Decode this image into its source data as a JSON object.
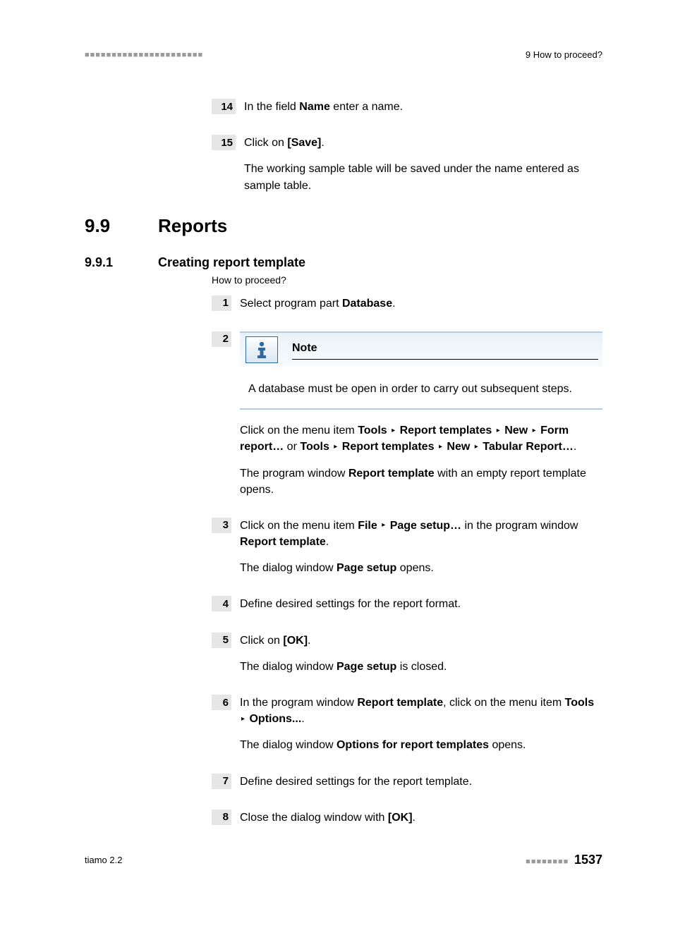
{
  "header": {
    "left_decoration": "■■■■■■■■■■■■■■■■■■■■■■",
    "right": "9 How to proceed?"
  },
  "top_steps": {
    "s14": {
      "num": "14",
      "pre": "In the field ",
      "bold": "Name",
      "post": " enter a name."
    },
    "s15": {
      "num": "15",
      "pre": "Click on ",
      "bold": "[Save]",
      "post": ".",
      "para2": "The working sample table will be saved under the name entered as sample table."
    }
  },
  "h1": {
    "num": "9.9",
    "title": "Reports"
  },
  "h2": {
    "num": "9.9.1",
    "title": "Creating report template"
  },
  "subcaption": "How to proceed?",
  "steps": {
    "s1": {
      "num": "1",
      "pre": "Select program part ",
      "bold": "Database",
      "post": "."
    },
    "s2": {
      "num": "2",
      "note_title": "Note",
      "note_body": "A database must be open in order to carry out subsequent steps.",
      "menu": {
        "pre": "Click on the menu item ",
        "t1": "Tools",
        "arrow": "▸",
        "t2": "Report templates",
        "t3": "New",
        "t4": "Form report…",
        "or": " or ",
        "u1": "Tools",
        "u2": "Report templates",
        "u3": "New",
        "u4": "Tabular Report…",
        "post": "."
      },
      "p2_pre": "The program window ",
      "p2_bold": "Report template",
      "p2_post": " with an empty report template opens."
    },
    "s3": {
      "num": "3",
      "p1_pre": "Click on the menu item ",
      "p1_b1": "File",
      "arrow": "▸",
      "p1_b2": "Page setup…",
      "p1_mid": " in the program window ",
      "p1_b3": "Report template",
      "p1_post": ".",
      "p2_pre": "The dialog window ",
      "p2_bold": "Page setup",
      "p2_post": " opens."
    },
    "s4": {
      "num": "4",
      "text": "Define desired settings for the report format."
    },
    "s5": {
      "num": "5",
      "p1_pre": "Click on ",
      "p1_bold": "[OK]",
      "p1_post": ".",
      "p2_pre": "The dialog window ",
      "p2_bold": "Page setup",
      "p2_post": " is closed."
    },
    "s6": {
      "num": "6",
      "p1_pre": "In the program window ",
      "p1_b1": "Report template",
      "p1_mid": ", click on the menu item ",
      "p1_b2": "Tools",
      "arrow": "▸",
      "p1_b3": "Options...",
      "p1_post": ".",
      "p2_pre": "The dialog window ",
      "p2_bold": "Options for report templates",
      "p2_post": " opens."
    },
    "s7": {
      "num": "7",
      "text": "Define desired settings for the report template."
    },
    "s8": {
      "num": "8",
      "pre": "Close the dialog window with ",
      "bold": "[OK]",
      "post": "."
    }
  },
  "footer": {
    "left": "tiamo 2.2",
    "dots": "■■■■■■■■",
    "page": "1537"
  }
}
